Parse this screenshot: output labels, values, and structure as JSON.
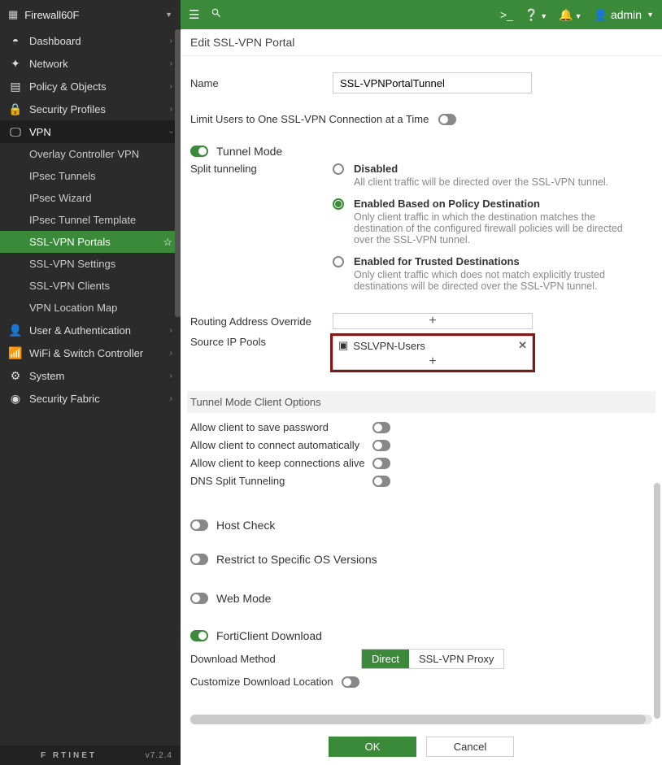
{
  "device_name": "Firewall60F",
  "sidebar": {
    "items": [
      {
        "icon": "◐",
        "label": "Dashboard"
      },
      {
        "icon": "✦",
        "label": "Network"
      },
      {
        "icon": "📋",
        "label": "Policy & Objects"
      },
      {
        "icon": "🔒",
        "label": "Security Profiles"
      },
      {
        "icon": "🖵",
        "label": "VPN",
        "expanded": true,
        "sub": [
          "Overlay Controller VPN",
          "IPsec Tunnels",
          "IPsec Wizard",
          "IPsec Tunnel Template",
          "SSL-VPN Portals",
          "SSL-VPN Settings",
          "SSL-VPN Clients",
          "VPN Location Map"
        ],
        "selected_sub": 4
      },
      {
        "icon": "👤",
        "label": "User & Authentication"
      },
      {
        "icon": "📶",
        "label": "WiFi & Switch Controller"
      },
      {
        "icon": "⚙",
        "label": "System"
      },
      {
        "icon": "◑",
        "label": "Security Fabric"
      }
    ],
    "brand": "F   RTINET",
    "version": "v7.2.4"
  },
  "topbar": {
    "user_label": "admin"
  },
  "page": {
    "title": "Edit SSL-VPN Portal",
    "name_label": "Name",
    "name_value": "SSL-VPNPortalTunnel",
    "limit_label": "Limit Users to One SSL-VPN Connection at a Time",
    "tunnel_mode_label": "Tunnel Mode",
    "split_label": "Split tunneling",
    "split_options": [
      {
        "title": "Disabled",
        "desc": "All client traffic will be directed over the SSL-VPN tunnel."
      },
      {
        "title": "Enabled Based on Policy Destination",
        "desc": "Only client traffic in which the destination matches the destination of the configured firewall policies will be directed over the SSL-VPN tunnel."
      },
      {
        "title": "Enabled for Trusted Destinations",
        "desc": "Only client traffic which does not match explicitly trusted destinations will be directed over the SSL-VPN tunnel."
      }
    ],
    "split_selected": 1,
    "routing_override_label": "Routing Address Override",
    "source_pools_label": "Source IP Pools",
    "source_pool_item": "SSLVPN-Users",
    "client_opts_header": "Tunnel Mode Client Options",
    "opt_save_pw": "Allow client to save password",
    "opt_auto_connect": "Allow client to connect automatically",
    "opt_keep_alive": "Allow client to keep connections alive",
    "opt_dns_split": "DNS Split Tunneling",
    "host_check_label": "Host Check",
    "restrict_os_label": "Restrict to Specific OS Versions",
    "web_mode_label": "Web Mode",
    "forticlient_dl_label": "FortiClient Download",
    "download_method_label": "Download Method",
    "download_methods": [
      "Direct",
      "SSL-VPN Proxy"
    ],
    "download_method_selected": 0,
    "custom_dl_loc_label": "Customize Download Location",
    "ok_label": "OK",
    "cancel_label": "Cancel"
  }
}
